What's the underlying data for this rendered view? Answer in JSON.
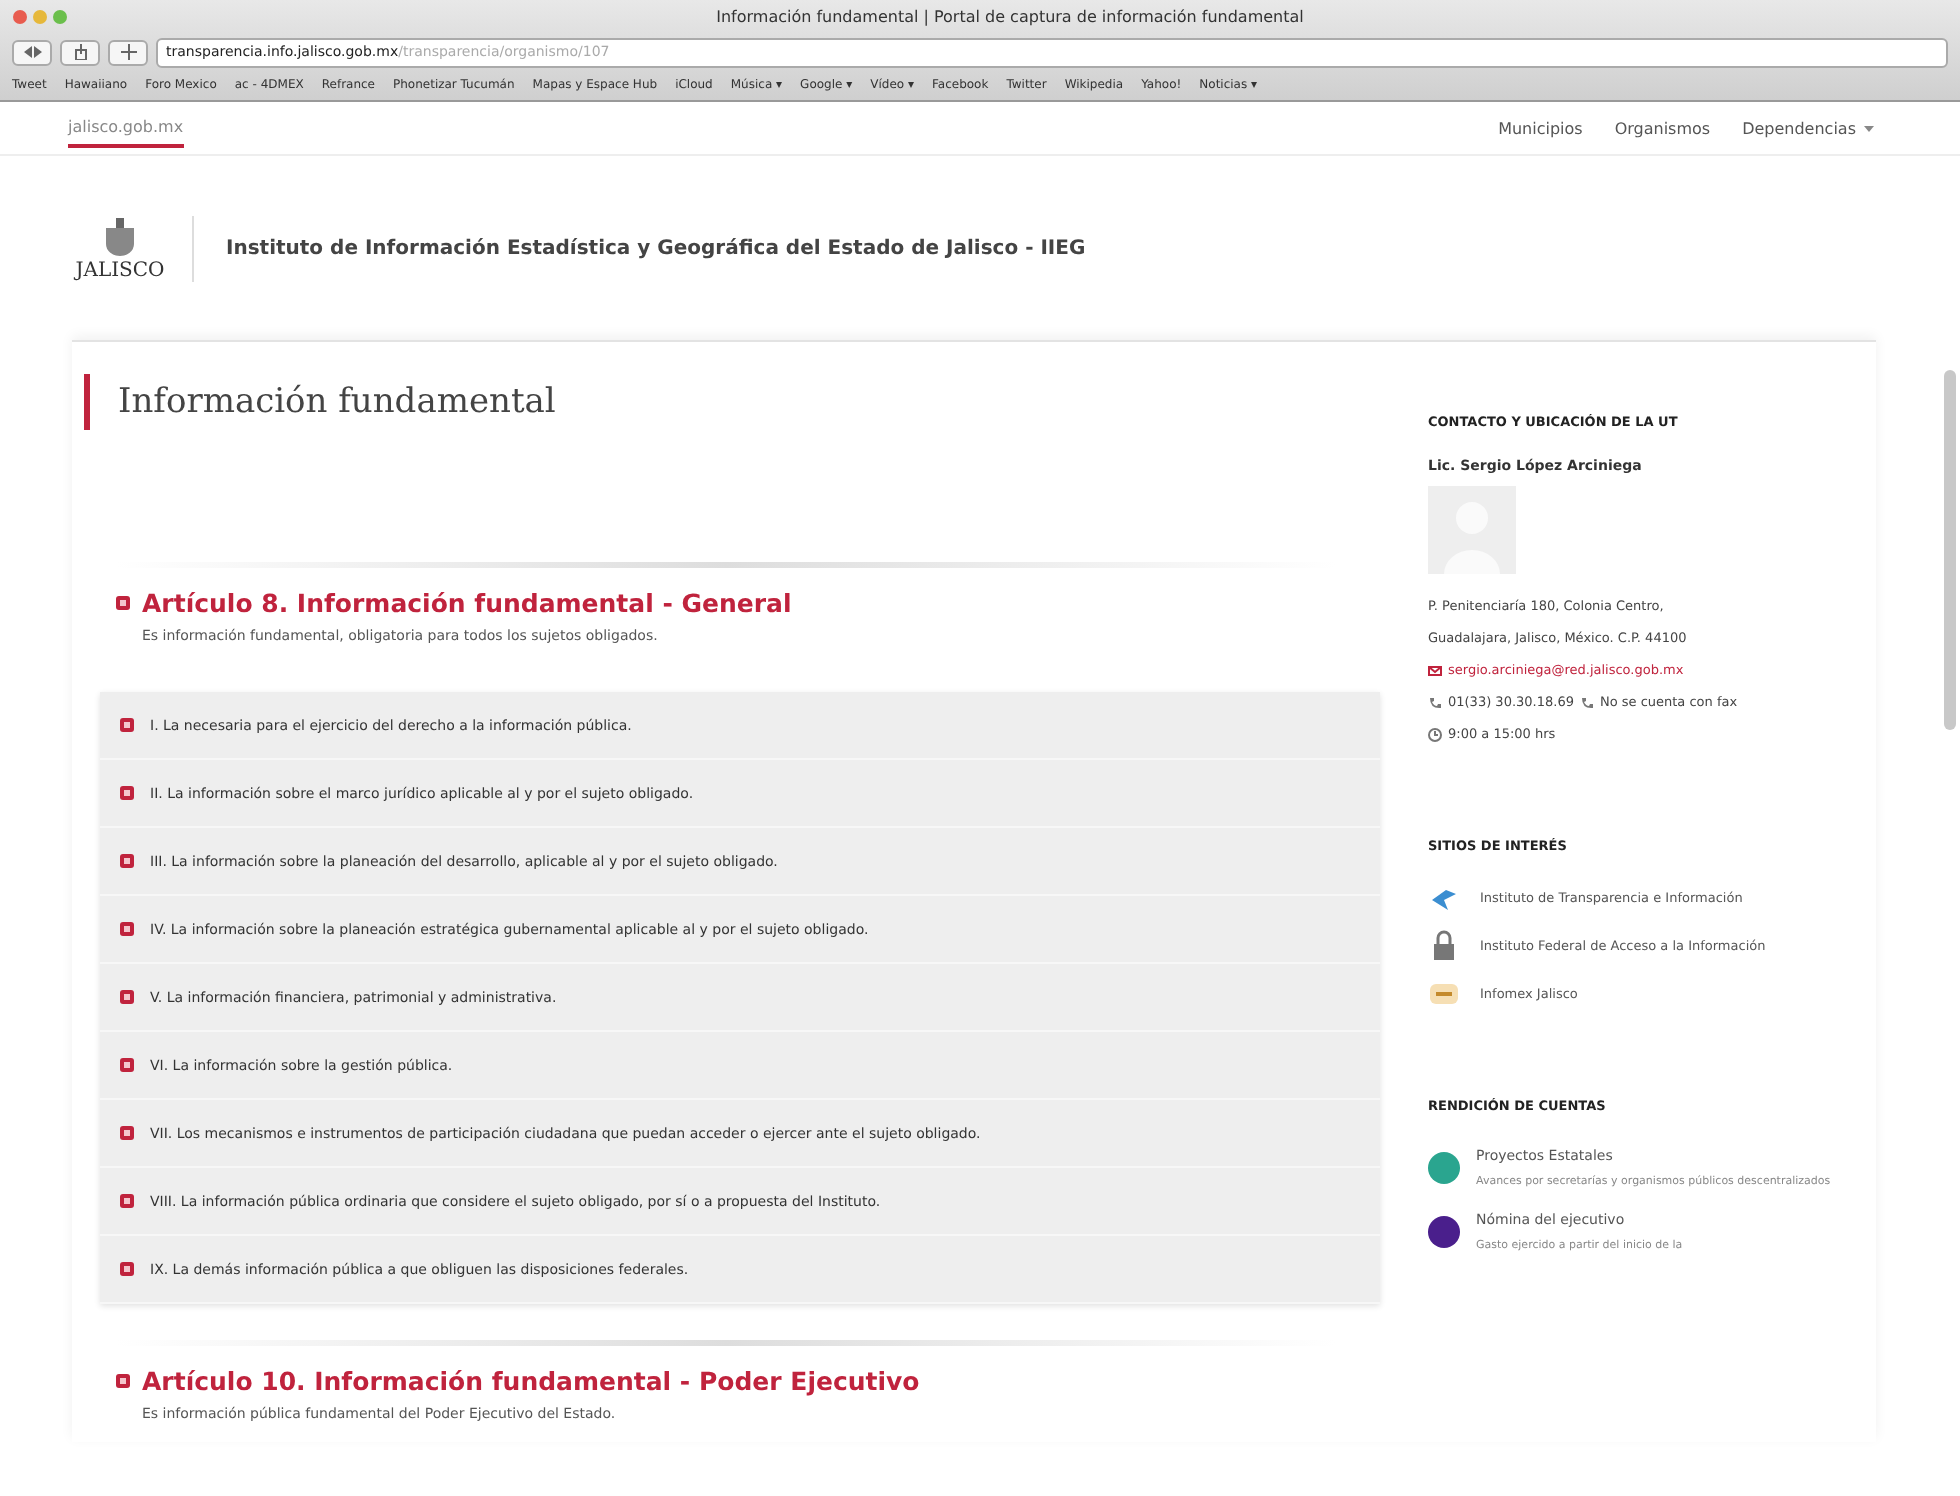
{
  "window": {
    "title": "Información fundamental | Portal de captura de información fundamental"
  },
  "address": {
    "host": "transparencia.info.jalisco.gob.mx",
    "path": "/transparencia/organismo/107"
  },
  "bookmarks": [
    "Tweet",
    "Hawaiiano",
    "Foro Mexico",
    "ac - 4DMEX",
    "Refrance",
    "Phonetizar Tucumán",
    "Mapas y Espace Hub",
    "iCloud",
    "Música ▾",
    "Google ▾",
    "Vídeo ▾",
    "Facebook",
    "Twitter",
    "Wikipedia",
    "Yahoo!",
    "Noticias ▾"
  ],
  "topbar": {
    "site": "jalisco.gob.mx",
    "links": [
      {
        "label": "Municipios",
        "dropdown": false
      },
      {
        "label": "Organismos",
        "dropdown": false
      },
      {
        "label": "Dependencias",
        "dropdown": true
      }
    ]
  },
  "header": {
    "logo_text": "JALISCO",
    "title": "Instituto de Información Estadística y Geográfica del Estado de Jalisco - IIEG"
  },
  "page_title": "Información fundamental",
  "articles": [
    {
      "title": "Artículo 8. Información fundamental - General",
      "subtitle": "Es información fundamental, obligatoria para todos los sujetos obligados.",
      "items": [
        "I. La necesaria para el ejercicio del derecho a la información pública.",
        "II. La información sobre el marco jurídico aplicable al y por el sujeto obligado.",
        "III. La información sobre la planeación del desarrollo, aplicable al y por el sujeto obligado.",
        "IV. La información sobre la planeación estratégica gubernamental aplicable al y por el sujeto obligado.",
        "V. La información financiera, patrimonial y administrativa.",
        "VI. La información sobre la gestión pública.",
        "VII. Los mecanismos e instrumentos de participación ciudadana que puedan acceder o ejercer ante el sujeto obligado.",
        "VIII. La información pública ordinaria que considere el sujeto obligado, por sí o a propuesta del Instituto.",
        "IX. La demás información pública a que obliguen las disposiciones federales."
      ]
    },
    {
      "title": "Artículo 10. Información fundamental - Poder Ejecutivo",
      "subtitle": "Es información pública fundamental del Poder Ejecutivo del Estado."
    }
  ],
  "contact": {
    "heading": "CONTACTO Y UBICACIÓN DE LA UT",
    "name": "Lic. Sergio López Arciniega",
    "address_lines": [
      "P. Penitenciaría 180, Colonia Centro,",
      "Guadalajara, Jalisco, México. C.P. 44100"
    ],
    "email": "sergio.arciniega@red.jalisco.gob.mx",
    "phone": "01(33) 30.30.18.69",
    "fax": "No se cuenta con fax",
    "hours": "9:00 a 15:00 hrs"
  },
  "sites": {
    "heading": "SITIOS DE INTERÉS",
    "items": [
      {
        "kind": "itei",
        "label": "Instituto de Transparencia e Información"
      },
      {
        "kind": "ifai",
        "label": "Instituto Federal de Acceso a la Información"
      },
      {
        "kind": "infomex",
        "label": "Infomex Jalisco"
      }
    ]
  },
  "accounts": {
    "heading": "RENDICIÓN DE CUENTAS",
    "items": [
      {
        "title": "Proyectos Estatales",
        "desc": "Avances por secretarías y organismos públicos descentralizados",
        "color": "#2aa58f"
      },
      {
        "title": "Nómina del ejecutivo",
        "desc": "Gasto ejercido a partir del inicio de la",
        "color": "#4a1f8c"
      }
    ]
  }
}
